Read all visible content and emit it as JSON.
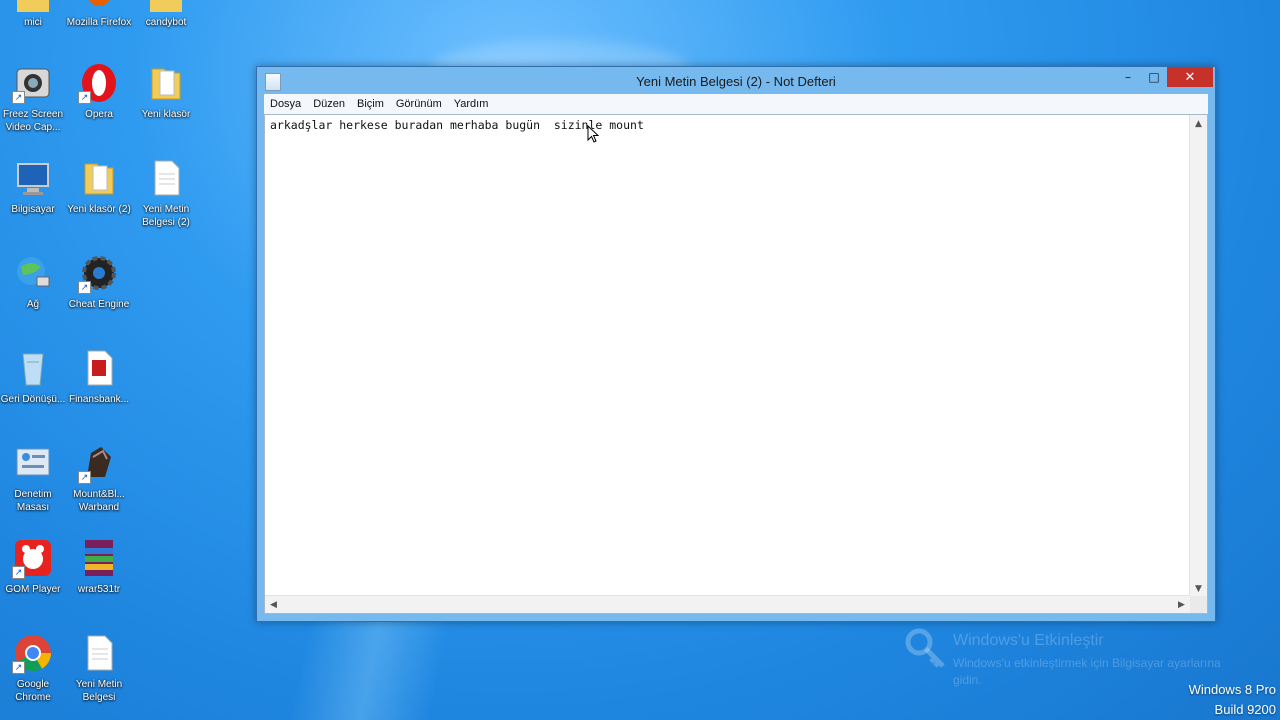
{
  "desktop": {
    "icons": [
      {
        "label": "mici",
        "icon": "folder-icon"
      },
      {
        "label": "Mozilla Firefox",
        "icon": "firefox-icon"
      },
      {
        "label": "candybot",
        "icon": "folder-icon"
      },
      {
        "label": "Freez Screen Video Cap...",
        "icon": "capture-app-icon"
      },
      {
        "label": "Opera",
        "icon": "opera-icon"
      },
      {
        "label": "Yeni klasör",
        "icon": "folder-icon"
      },
      {
        "label": "Bilgisayar",
        "icon": "computer-icon"
      },
      {
        "label": "Yeni klasör (2)",
        "icon": "folder-icon"
      },
      {
        "label": "Yeni Metin Belgesi (2)",
        "icon": "text-file-icon"
      },
      {
        "label": "Ağ",
        "icon": "network-icon"
      },
      {
        "label": "Cheat Engine",
        "icon": "cheat-engine-icon"
      },
      {
        "label": "Geri Dönüşü...",
        "icon": "recycle-bin-icon"
      },
      {
        "label": "Finansbank...",
        "icon": "pdf-file-icon"
      },
      {
        "label": "Denetim Masası",
        "icon": "control-panel-icon"
      },
      {
        "label": "Mount&Bl... Warband",
        "icon": "game-icon"
      },
      {
        "label": "GOM Player",
        "icon": "gom-player-icon"
      },
      {
        "label": "wrar531tr",
        "icon": "winrar-icon"
      },
      {
        "label": "Google Chrome",
        "icon": "chrome-icon"
      },
      {
        "label": "Yeni Metin Belgesi",
        "icon": "text-file-icon"
      }
    ]
  },
  "notepad": {
    "title": "Yeni Metin Belgesi (2) - Not Defteri",
    "menu": [
      "Dosya",
      "Düzen",
      "Biçim",
      "Görünüm",
      "Yardım"
    ],
    "content": "arkadşlar herkese buradan merhaba bugün  sizinle mount",
    "controls": {
      "minimize": "–",
      "maximize": "□",
      "close": "✕"
    }
  },
  "watermark": {
    "title": "Windows'u Etkinleştir",
    "subtitle": "Windows'u etkinleştirmek için Bilgisayar ayarlarına gidin."
  },
  "os_build": {
    "line1": "Windows 8 Pro",
    "line2": "Build 9200"
  },
  "colors": {
    "desktop_blue": "#1f86e0",
    "window_frame": "#76b9ee",
    "close_button": "#c7312a"
  }
}
